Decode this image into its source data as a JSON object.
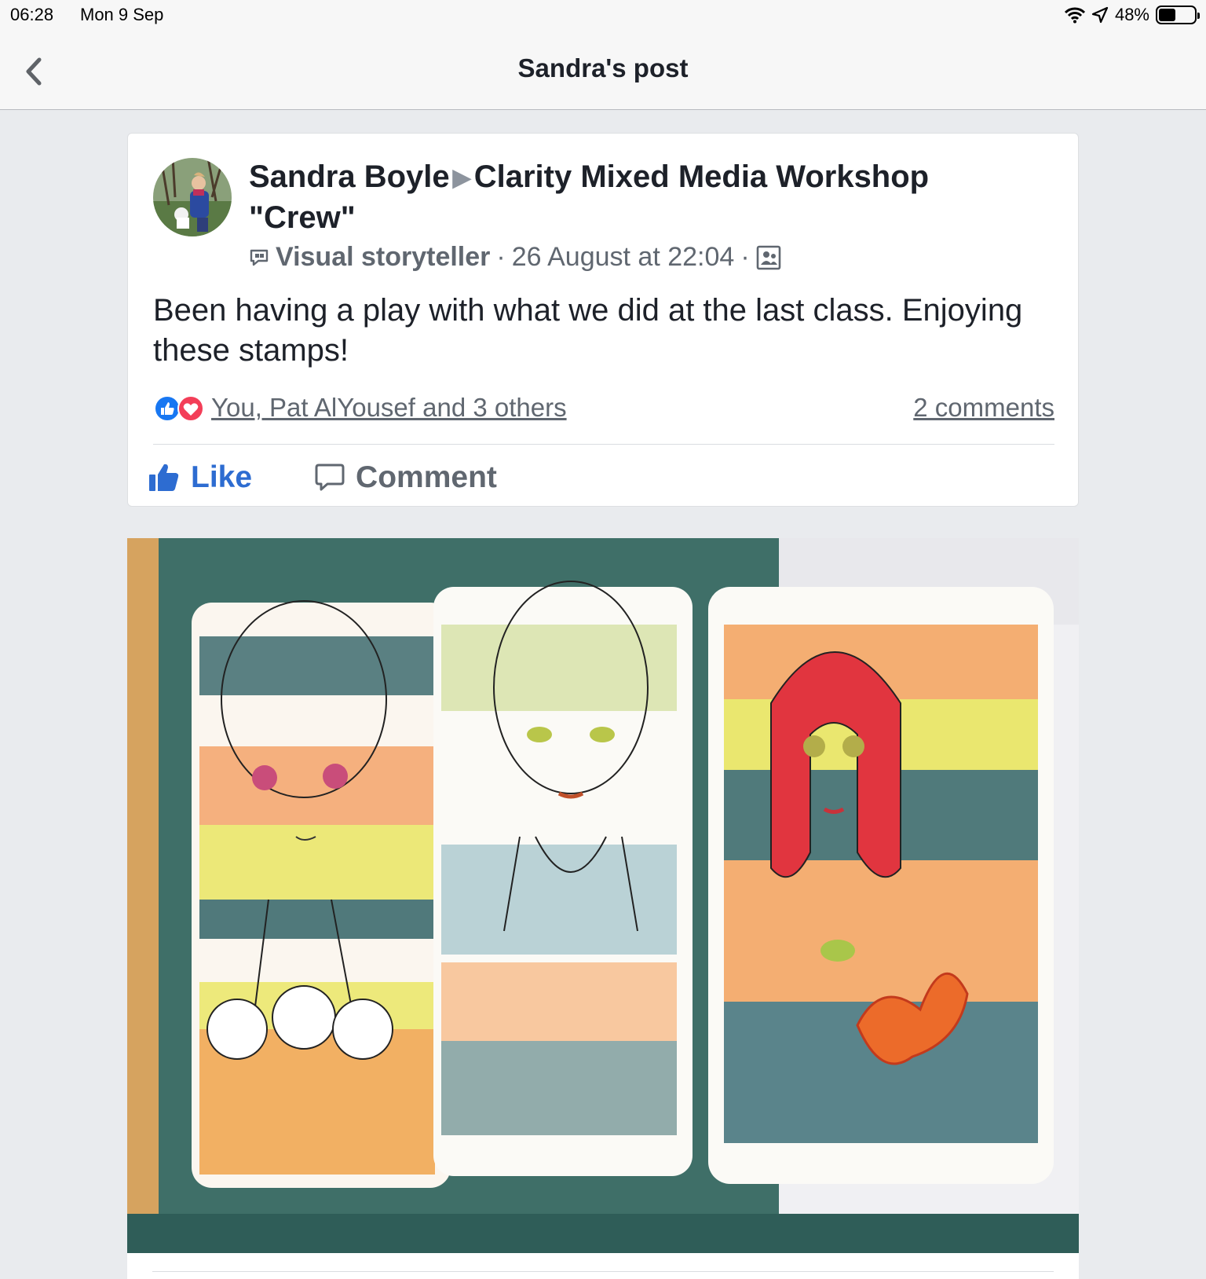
{
  "status_bar": {
    "time": "06:28",
    "date": "Mon 9 Sep",
    "battery_text": "48%",
    "battery_level": 0.48
  },
  "nav": {
    "title": "Sandra's post",
    "back_icon": "chevron-left-icon"
  },
  "post": {
    "author": "Sandra Boyle",
    "group": "Clarity Mixed Media Workshop \"Crew\"",
    "badge": "Visual storyteller",
    "timestamp": "26 August at 22:04",
    "privacy_icon": "group-members-icon",
    "text": "Been having a play with what we did at the last class. Enjoying these stamps!",
    "reactions_text": "You, Pat AlYousef and 3 others",
    "comments_text": "2 comments",
    "like_label": "Like",
    "comment_label": "Comment"
  },
  "colors": {
    "accent": "#2d6cd1",
    "like_reaction": "#1877f2",
    "love_reaction": "#f33e58",
    "background": "#e9ebee"
  }
}
